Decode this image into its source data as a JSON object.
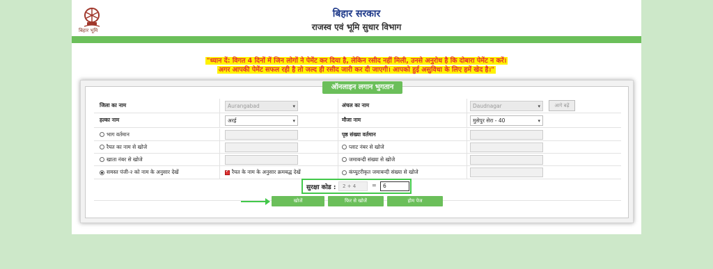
{
  "header": {
    "logo_text": "बिहार भूमि",
    "title": "बिहार सरकार",
    "subtitle": "राजस्व एवं भूमि सुधार विभाग"
  },
  "notice": {
    "line1": "\"ध्यान दें: विगत 4 दिनों में जिन लोगों ने पेमेंट कर दिया है, लेकिन रसीद नहीं मिली, उनसे अनुरोध है कि दोबारा पेमेंट न करें।",
    "line2": "अगर आपकी पेमेंट सफल रही है तो जल्द ही रसीद जारी कर दी जाएगी। आपको हुई असुविधा के लिए हमें खेद है।\""
  },
  "panel": {
    "title": "ऑनलाइन लगान भुगतान"
  },
  "form": {
    "district_label": "जिला का नाम",
    "district_value": "Aurangabad",
    "circle_label": "अंचल का नाम",
    "circle_value": "Daudnagar",
    "next_button": "आगे बढ़ें",
    "halka_label": "हल्का नाम",
    "halka_value": "अरई",
    "mauja_label": "मौजा नाम",
    "mauja_value": "मुसेपुर सेरा - 40",
    "opt_bhag": "भाग वर्तमान",
    "page_count_label": "पृष्ठ संख्या वर्तमान",
    "opt_raiyat": "रैयत का नाम से खोजे",
    "opt_plot": "प्लाट नंबर से खोजे",
    "opt_khata": "खाता नंबर से खोजे",
    "opt_jamabandi": "जमाबन्दी संख्या से खोजे",
    "opt_samast": "समस्त पंजी-२ को नाम के अनुसार देखें",
    "chk_raiyat_order": "रैयत के नाम के अनुसार क्रमबद्ध देखें",
    "opt_computer": "कंप्यूटरीकृत जमाबन्दी संख्या से खोजे"
  },
  "captcha": {
    "label": "सुरक्षा कोड :",
    "question": "2 + 4",
    "equals": "=",
    "answer": "6"
  },
  "actions": {
    "search": "खोजें",
    "search_again": "फिर से खोजें",
    "home": "होम पेज"
  },
  "colors": {
    "accent_green": "#6bbf5a",
    "notice_text": "#e53030",
    "notice_highlight": "#fff200",
    "background": "#cde8c9"
  },
  "icons": {
    "logo": "bihar-emblem-icon",
    "arrow": "arrow-right-icon"
  }
}
